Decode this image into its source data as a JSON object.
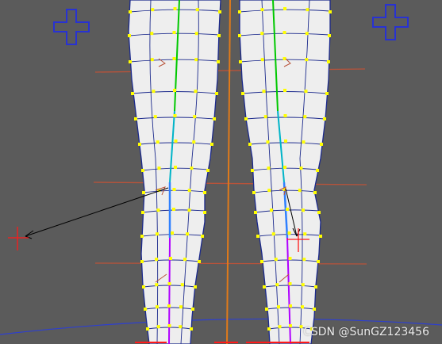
{
  "viewport": {
    "background": "#5b5b5b",
    "view": "front orthographic",
    "shading": "smooth shaded with wireframe",
    "selection": "vertices selected"
  },
  "model": {
    "object": "legs mesh",
    "mesh_color": "#eeeeee",
    "wire_color": "#1c2a8c",
    "vertex_color": "#ffff00"
  },
  "rig": {
    "ik_handles": [
      {
        "name": "ik-handle-left",
        "color": "#ff1a1a"
      },
      {
        "name": "ik-handle-right",
        "color": "#ff1a1a"
      }
    ],
    "pole_vector_lines": {
      "color": "#000000"
    },
    "joint_planes": {
      "color": "#b8533a"
    },
    "bone_chain_colors": [
      "#00c800",
      "#00b4c8",
      "#2f80ff",
      "#b000ff"
    ],
    "spine_line_color": "#e07a1a",
    "controls": [
      {
        "name": "control-cross-left",
        "color": "#2832d2"
      },
      {
        "name": "control-cross-right",
        "color": "#2832d2"
      }
    ]
  },
  "watermark": "CSDN @SunGZ123456"
}
